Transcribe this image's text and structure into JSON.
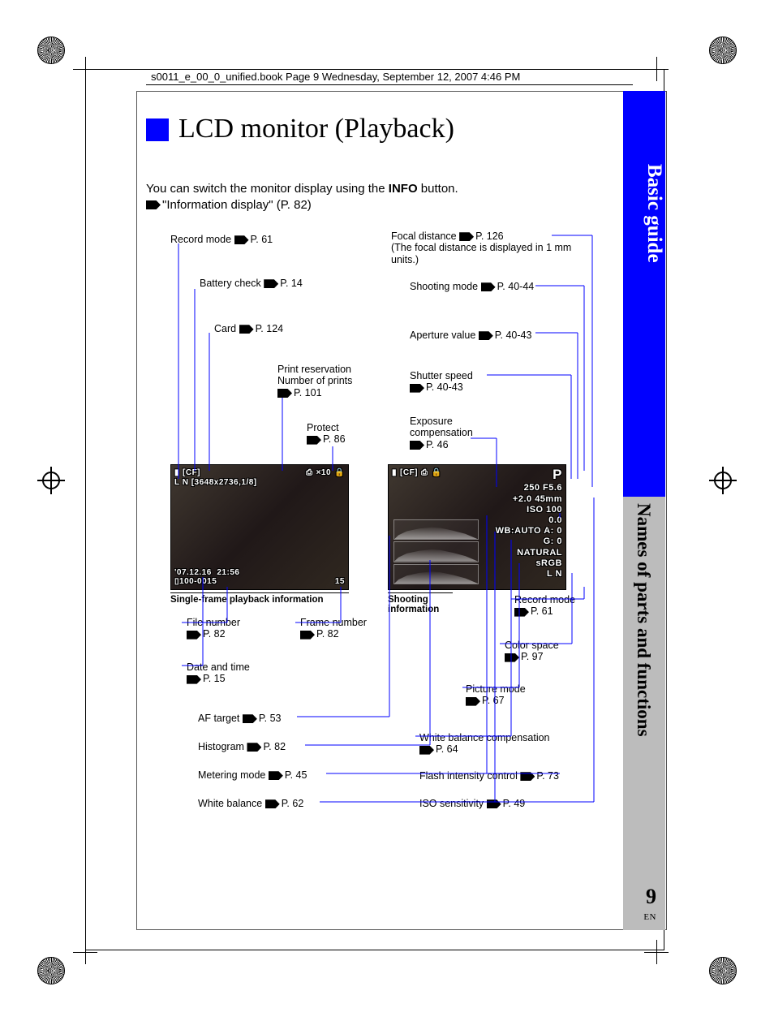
{
  "header": "s0011_e_00_0_unified.book  Page 9  Wednesday, September 12, 2007  4:46 PM",
  "title": "LCD monitor (Playback)",
  "intro": {
    "line1a": "You can switch the monitor display using the ",
    "info": "INFO",
    "line1b": " button.",
    "line2": "\"Information display\" (P. 82)"
  },
  "tabs": {
    "blue": "Basic guide",
    "gray": "Names of parts and functions"
  },
  "page": {
    "num": "9",
    "lang": "EN"
  },
  "left_callouts": {
    "record_mode": "Record mode",
    "record_mode_p": "P. 61",
    "battery": "Battery check",
    "battery_p": "P. 14",
    "card": "Card",
    "card_p": "P. 124",
    "print_res1": "Print reservation",
    "print_res2": "Number of prints",
    "print_res_p": "P. 101",
    "protect": "Protect",
    "protect_p": "P. 86",
    "file_num": "File number",
    "file_num_p": "P. 82",
    "frame_num": "Frame number",
    "frame_num_p": "P. 82",
    "date_time": "Date and time",
    "date_time_p": "P. 15",
    "af": "AF target",
    "af_p": "P. 53",
    "hist": "Histogram",
    "hist_p": "P. 82",
    "meter": "Metering mode",
    "meter_p": "P. 45",
    "wb": "White balance",
    "wb_p": "P. 62"
  },
  "right_callouts": {
    "focal1": "Focal distance",
    "focal_p": "P. 126",
    "focal2": "(The focal distance is displayed in 1 mm units.)",
    "shoot_mode": "Shooting mode",
    "shoot_mode_p": "P. 40-44",
    "aperture": "Aperture value",
    "aperture_p": "P. 40-43",
    "shutter": "Shutter speed",
    "shutter_p": "P. 40-43",
    "exp1": "Exposure",
    "exp2": "compensation",
    "exp_p": "P. 46",
    "rec_mode2": "Record mode",
    "rec_mode2_p": "P. 61",
    "cspace": "Color space",
    "cspace_p": "P. 97",
    "pmode": "Picture mode",
    "pmode_p": "P. 67",
    "wbcomp": "White balance compensation",
    "wbcomp_p": "P. 64",
    "flash": "Flash intensity control",
    "flash_p": "P. 73",
    "iso": "ISO sensitivity",
    "iso_p": "P. 49"
  },
  "captions": {
    "left": "Single-frame playback information",
    "right1": "Shooting",
    "right2": "information"
  },
  "lcd1": {
    "top_icons": "[CF]",
    "x10": "×10",
    "size": "[3648x2736,1/8]",
    "mode_badge": "L N",
    "date": "'07.12.16",
    "time": "21:56",
    "file": "100-0015",
    "frame": "15"
  },
  "lcd2": {
    "top_icons": "[CF]",
    "P": "P",
    "l1": "250 F5.6",
    "l2": "+2.0 45mm",
    "l3": "ISO 100",
    "l4": "0.0",
    "l5": "WB:AUTO A: 0",
    "l6": "G: 0",
    "l7": "NATURAL",
    "l8": "sRGB",
    "l9": "L N"
  }
}
